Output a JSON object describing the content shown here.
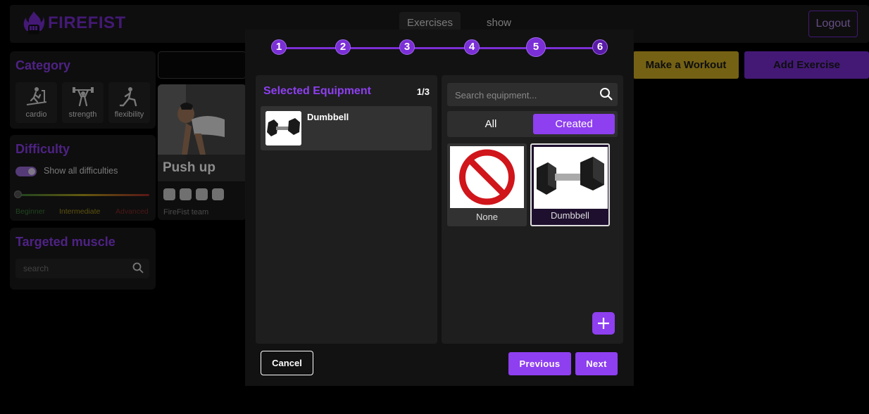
{
  "app": {
    "brand": "FIREFIST",
    "nav_tabs": [
      {
        "label": "Exercises",
        "active": true
      },
      {
        "label": "show",
        "active": false
      }
    ],
    "logout_label": "Logout",
    "accent_color": "#7b2fd6"
  },
  "sidebar": {
    "category": {
      "title": "Category",
      "items": [
        {
          "label": "cardio",
          "icon": "treadmill-icon"
        },
        {
          "label": "strength",
          "icon": "weightlifter-icon"
        },
        {
          "label": "flexibility",
          "icon": "stretching-icon"
        }
      ]
    },
    "difficulty": {
      "title": "Difficulty",
      "toggle_label": "Show all difficulties",
      "toggle_on": true,
      "levels": [
        "Beginner",
        "Intermediate",
        "Advanced"
      ]
    },
    "muscle": {
      "title": "Targeted muscle",
      "search_placeholder": "search"
    }
  },
  "main": {
    "card": {
      "title": "Push up",
      "author": "FireFist team",
      "muscle_icons": [
        "chest-muscle-icon",
        "torso-muscle-icon",
        "arm-muscle-icon",
        "abs-muscle-icon"
      ]
    },
    "make_workout_label": "Make a Workout",
    "add_exercise_label": "Add Exercise"
  },
  "modal": {
    "steps": [
      "1",
      "2",
      "3",
      "4",
      "5",
      "6"
    ],
    "current_step": 5,
    "selected_equipment": {
      "title": "Selected Equipment",
      "count": "1/3",
      "items": [
        {
          "name": "Dumbbell",
          "icon": "dumbbell-icon"
        }
      ]
    },
    "equipment": {
      "search_placeholder": "Search equipment...",
      "filters": [
        {
          "label": "All",
          "active": false
        },
        {
          "label": "Created",
          "active": true
        }
      ],
      "items": [
        {
          "name": "None",
          "icon": "none-icon",
          "selected": false
        },
        {
          "name": "Dumbbell",
          "icon": "dumbbell-icon",
          "selected": true
        }
      ]
    },
    "cancel_label": "Cancel",
    "previous_label": "Previous",
    "next_label": "Next"
  }
}
